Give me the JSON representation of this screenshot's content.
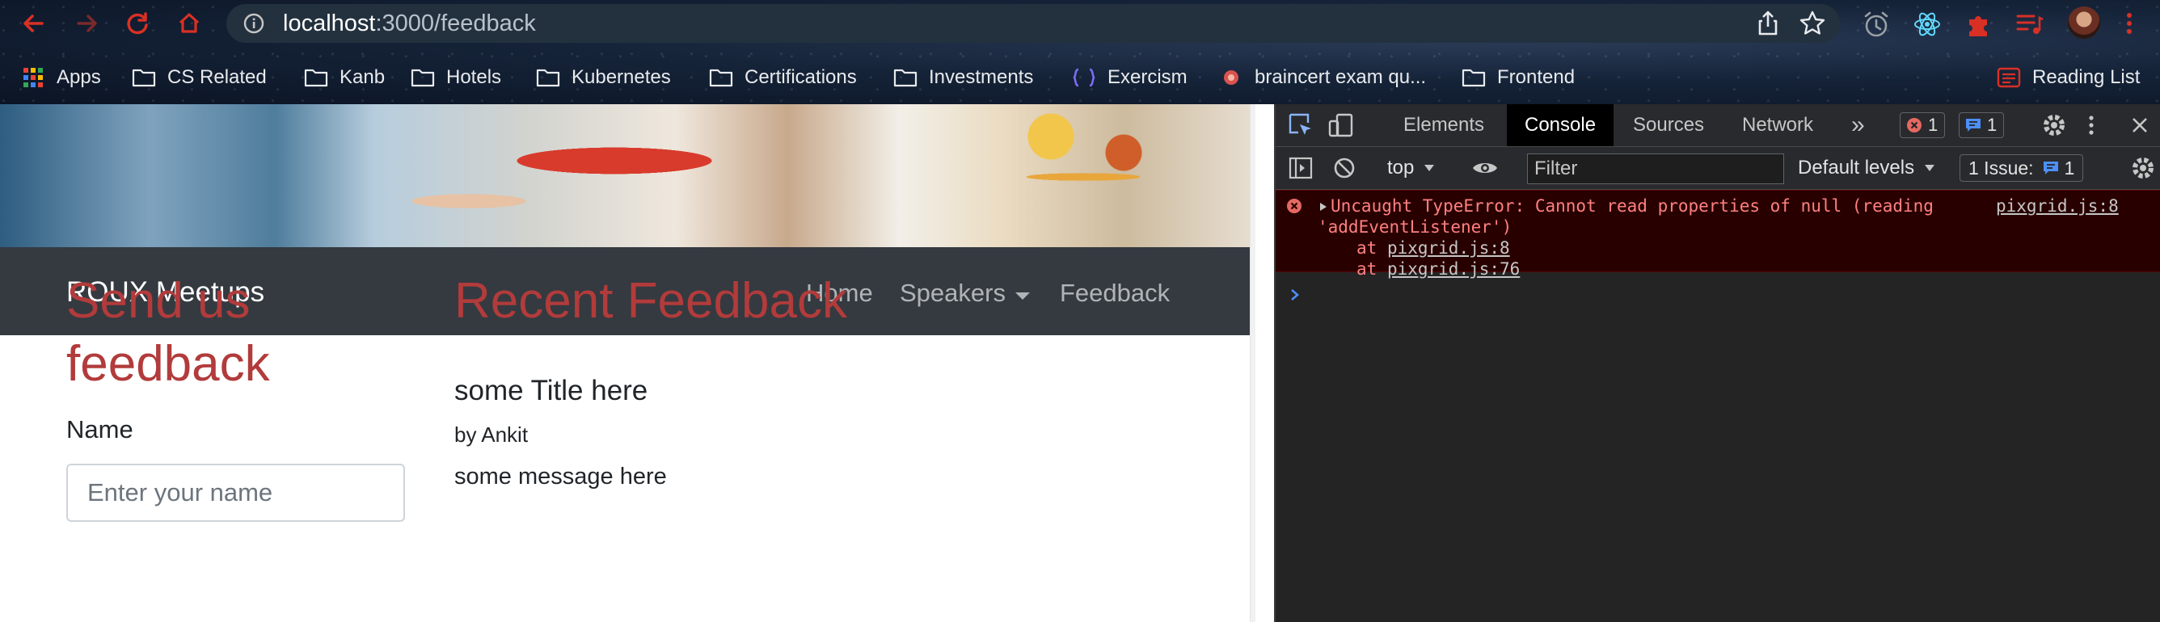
{
  "browser": {
    "url_host": "localhost",
    "url_rest": ":3000/feedback",
    "bookmarks": [
      {
        "label": "Apps",
        "icon": "apps-grid-icon"
      },
      {
        "label": "CS Related",
        "icon": "folder-icon"
      },
      {
        "label": "Kanb",
        "icon": "folder-icon"
      },
      {
        "label": "Hotels",
        "icon": "folder-icon"
      },
      {
        "label": "Kubernetes",
        "icon": "folder-icon"
      },
      {
        "label": "Certifications",
        "icon": "folder-icon"
      },
      {
        "label": "Investments",
        "icon": "folder-icon"
      },
      {
        "label": "Exercism",
        "icon": "exercism-icon"
      },
      {
        "label": "braincert exam qu...",
        "icon": "braincert-icon"
      },
      {
        "label": "Frontend",
        "icon": "folder-icon"
      }
    ],
    "reading_list": "Reading List"
  },
  "site": {
    "brand": "ROUX Meetups",
    "nav": {
      "home": "Home",
      "speakers": "Speakers",
      "feedback": "Feedback"
    },
    "form": {
      "title": "Send us feedback",
      "name_label": "Name",
      "name_placeholder": "Enter your name"
    },
    "recent": {
      "title": "Recent Feedback",
      "item": {
        "title": "some Title here",
        "author": "by Ankit",
        "message": "some message here"
      }
    }
  },
  "devtools": {
    "tabs": [
      "Elements",
      "Console",
      "Sources",
      "Network"
    ],
    "active_tab": "Console",
    "more_tabs": "»",
    "error_count": "1",
    "message_count": "1",
    "context": "top",
    "filter_placeholder": "Filter",
    "levels": "Default levels",
    "issues_label": "1 Issue:",
    "issues_count": "1",
    "error": {
      "line1": "Uncaught TypeError: Cannot read properties of null (reading",
      "line2": "'addEventListener')",
      "at_prefix": "at ",
      "stack1": "pixgrid.js:8",
      "stack2": "pixgrid.js:76",
      "source": "pixgrid.js:8"
    },
    "prompt": "›"
  },
  "colors": {
    "accent_red": "#b23b3b",
    "navbar": "#343a40",
    "error_bg": "#290000",
    "error_text": "#ff8080"
  }
}
